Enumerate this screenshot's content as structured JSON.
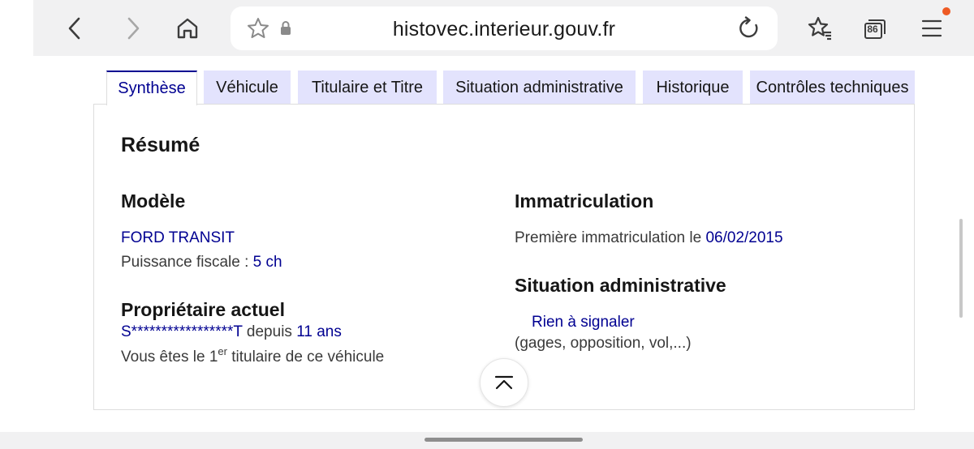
{
  "browser": {
    "url": "histovec.interieur.gouv.fr",
    "tab_count": "86",
    "notification_color": "#ee5a24"
  },
  "tabs": [
    {
      "label": "Synthèse",
      "active": true
    },
    {
      "label": "Véhicule",
      "active": false
    },
    {
      "label": "Titulaire et Titre",
      "active": false
    },
    {
      "label": "Situation administrative",
      "active": false
    },
    {
      "label": "Historique",
      "active": false
    },
    {
      "label": "Contrôles techniques",
      "active": false
    }
  ],
  "summary": {
    "title": "Résumé",
    "model": {
      "heading": "Modèle",
      "name": "FORD TRANSIT",
      "fiscal_label": "Puissance fiscale :",
      "fiscal_value": "5 ch"
    },
    "owner": {
      "heading": "Propriétaire actuel",
      "name": "S*****************T",
      "since_label": "depuis",
      "since_value": "11 ans",
      "rank_prefix": "Vous êtes le",
      "rank_number": "1",
      "rank_suffix_sup": "er",
      "rank_suffix": "titulaire de ce véhicule"
    },
    "registration": {
      "heading": "Immatriculation",
      "label": "Première immatriculation le",
      "date": "06/02/2015"
    },
    "admin": {
      "heading": "Situation administrative",
      "status": "Rien à signaler",
      "details": "(gages, opposition, vol,...)"
    }
  },
  "colors": {
    "accent": "#000091",
    "tab_inactive_bg": "#e3e3fd",
    "text": "#3a3a3a"
  }
}
